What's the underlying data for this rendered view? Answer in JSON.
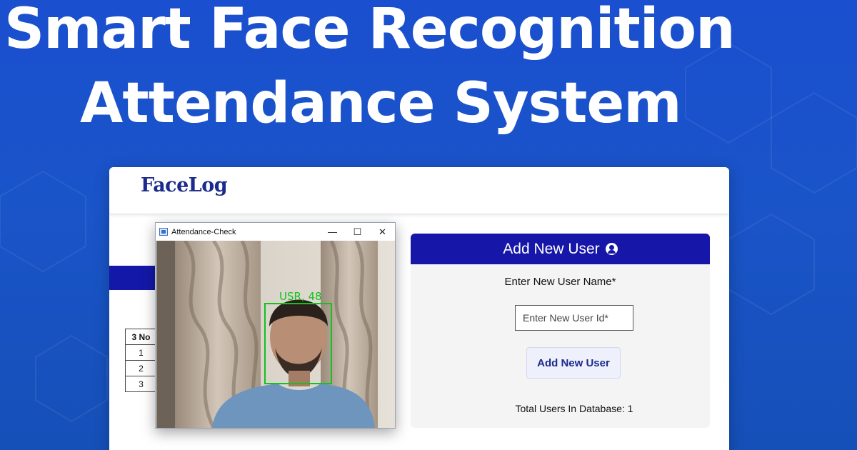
{
  "hero": {
    "line1": "Smart Face Recognition",
    "line2": "Attendance System"
  },
  "app": {
    "brand": "FaceLog",
    "table": {
      "header": "3 No",
      "rows": [
        "1",
        "2",
        "3"
      ]
    },
    "panel": {
      "title": "Add New User",
      "title_icon": "user-circle-icon",
      "name_label": "Enter New User Name*",
      "id_placeholder": "Enter New User Id*",
      "button_label": "Add New User",
      "total_users": "Total Users In Database: 1"
    }
  },
  "camera_window": {
    "title": "Attendance-Check",
    "app_icon": "app-window-icon",
    "controls": {
      "minimize": "—",
      "maximize": "☐",
      "close": "✕"
    },
    "detection_label": "USR, 48"
  },
  "colors": {
    "background": "#1a4fcf",
    "accent_navy": "#1616a8",
    "brand": "#1b2a8c",
    "detection_green": "#12c21e"
  }
}
